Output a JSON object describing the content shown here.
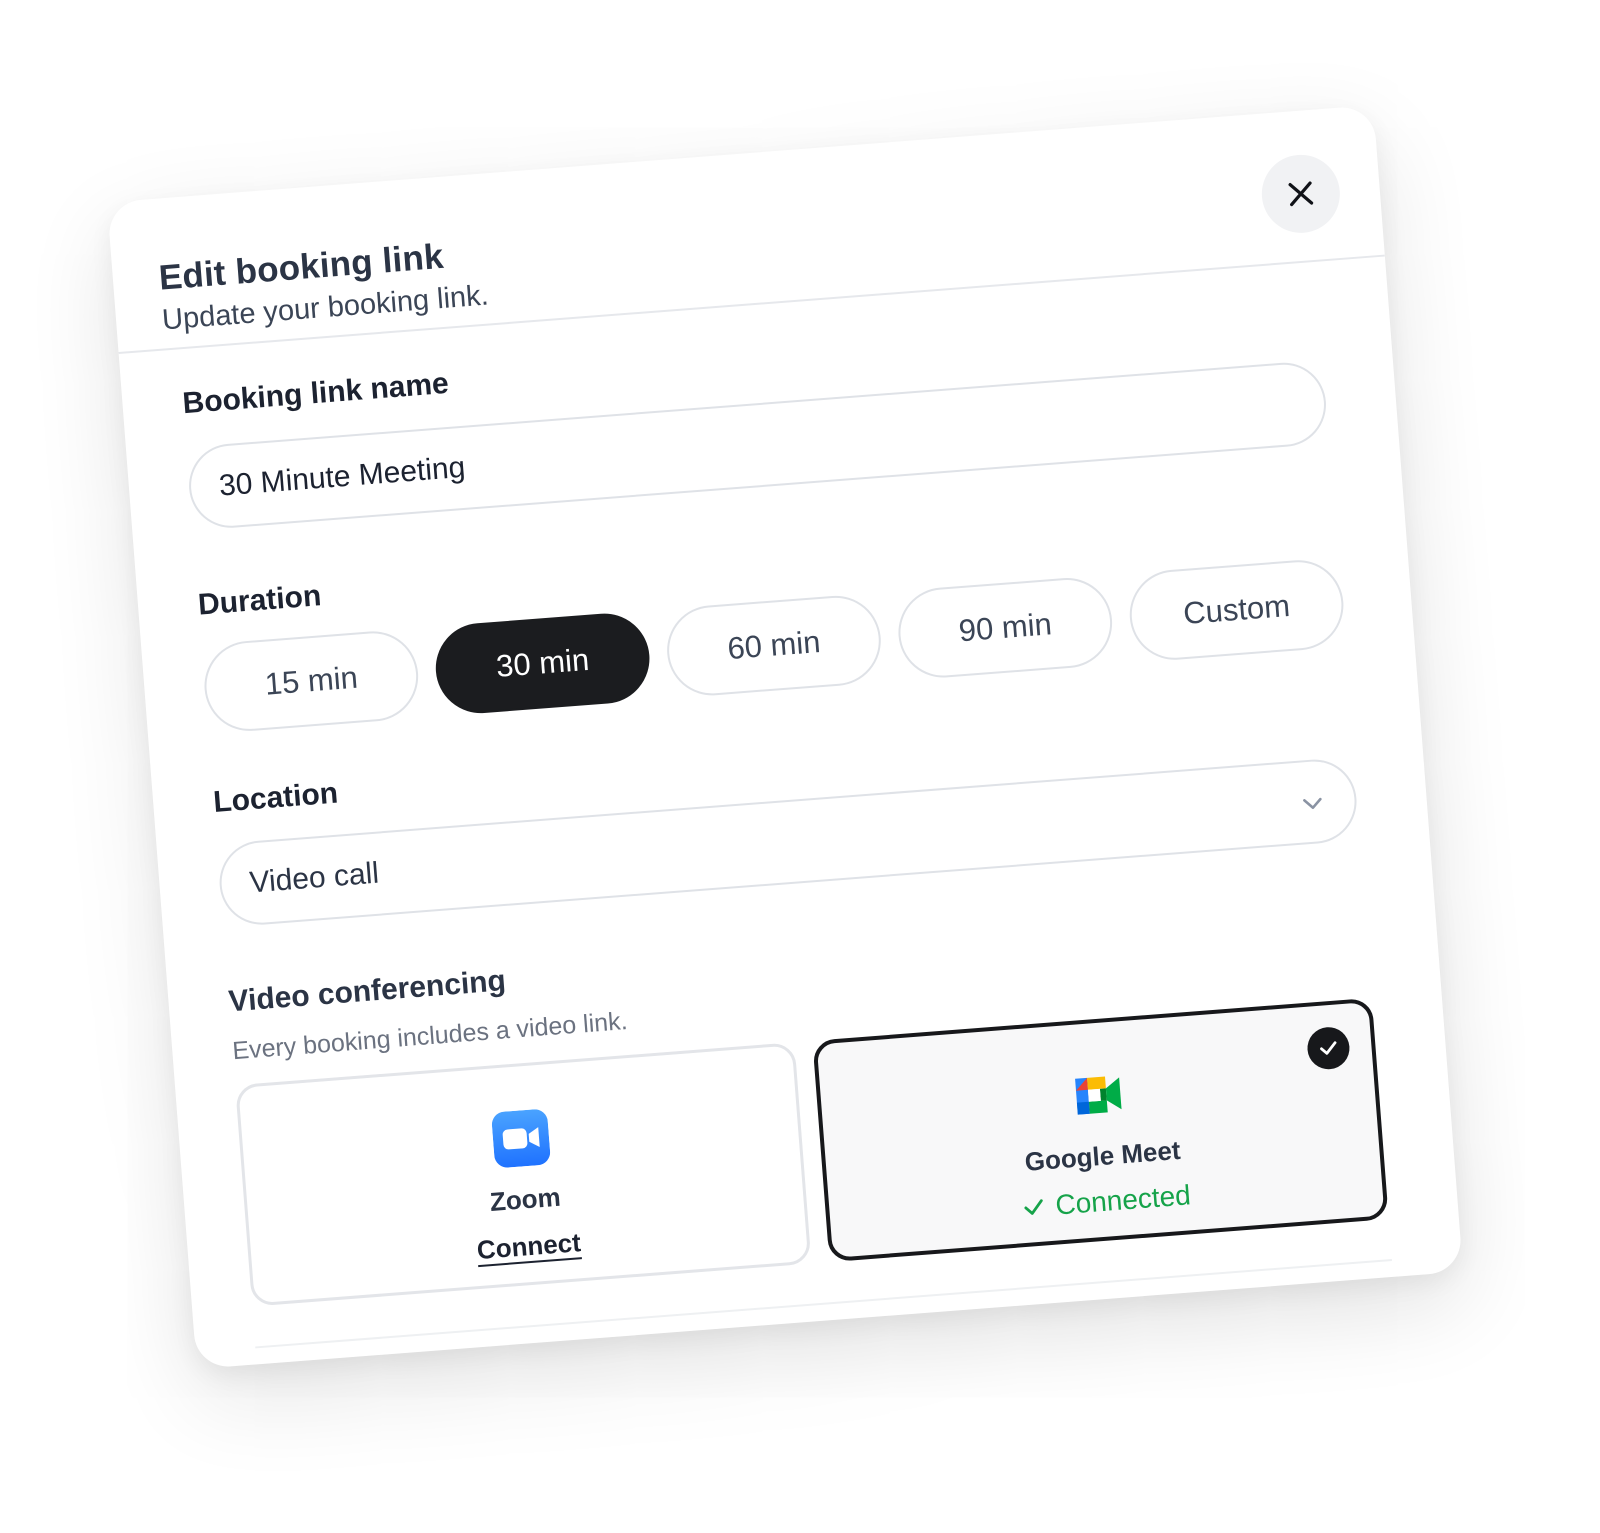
{
  "modal": {
    "title": "Edit booking link",
    "subtitle": "Update your booking link.",
    "close_icon": "close-icon"
  },
  "booking_name": {
    "label": "Booking link name",
    "value": "30 Minute Meeting"
  },
  "duration": {
    "label": "Duration",
    "options": [
      "15 min",
      "30 min",
      "60 min",
      "90 min",
      "Custom"
    ],
    "selected": "30 min"
  },
  "location": {
    "label": "Location",
    "value": "Video call",
    "icon": "chevron-down-icon"
  },
  "video_conferencing": {
    "title": "Video conferencing",
    "subtitle": "Every booking includes a video link.",
    "providers": [
      {
        "name": "Zoom",
        "action": "Connect",
        "icon": "zoom-icon"
      },
      {
        "name": "Google Meet",
        "status": "Connected",
        "icon": "google-meet-icon",
        "selected": true
      }
    ]
  },
  "colors": {
    "selected": "#1b1c1f",
    "connected": "#16a34a",
    "zoom": "#2d8cff"
  }
}
